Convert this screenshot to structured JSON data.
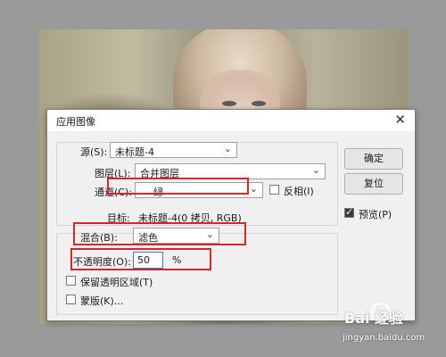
{
  "dialog": {
    "title": "应用图像",
    "close_glyph": "✕",
    "source": {
      "label": "源(S):",
      "value": "未标题-4"
    },
    "layer": {
      "label": "图层(L):",
      "value": "合并图层"
    },
    "channel": {
      "label": "通道(C):",
      "value": "绿"
    },
    "invert": {
      "label": "反相(I)",
      "checked": false
    },
    "target": {
      "label": "目标:",
      "value": "未标题-4(0 拷贝, RGB)"
    },
    "blend": {
      "label": "混合(B):",
      "value": "滤色"
    },
    "opacity": {
      "label": "不透明度(O):",
      "value": "50",
      "unit": "%"
    },
    "preserve_transparency": {
      "label": "保留透明区域(T)",
      "checked": false
    },
    "mask": {
      "label": "蒙版(K)...",
      "checked": false
    },
    "buttons": {
      "ok": "确定",
      "reset": "复位"
    },
    "preview": {
      "label": "预览(P)",
      "checked": true
    }
  },
  "watermark": {
    "brand": "Bai 经验",
    "url": "jingyan.baidu.com"
  },
  "colors": {
    "highlight_red": "#d7262b",
    "dialog_bg": "#f0f0f0"
  }
}
